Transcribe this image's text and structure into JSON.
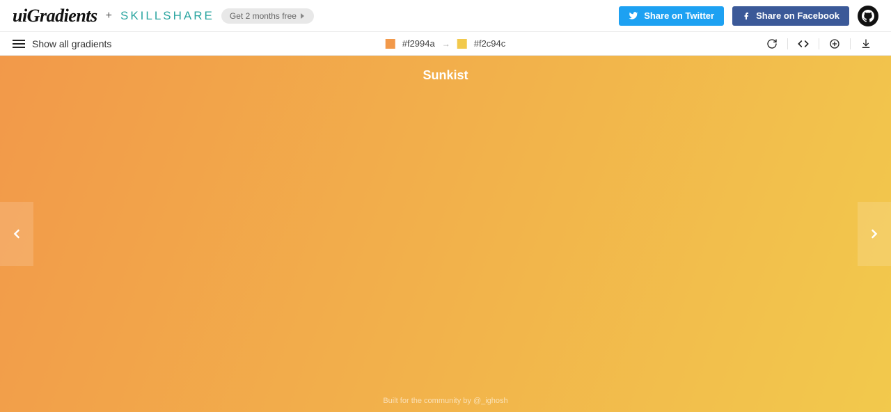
{
  "header": {
    "logo_text": "uiGradients",
    "plus": "+",
    "partner": "SKILLSHARE",
    "promo_label": "Get 2 months free",
    "share_twitter_label": "Share on Twitter",
    "share_facebook_label": "Share on Facebook"
  },
  "subbar": {
    "show_all_label": "Show all gradients",
    "color1_hex": "#f2994a",
    "color2_hex": "#f2c94c"
  },
  "gradient": {
    "name": "Sunkist",
    "color_start": "#f2994a",
    "color_end": "#f2c94c"
  },
  "footer": {
    "text": "Built for the community by @_ighosh"
  }
}
